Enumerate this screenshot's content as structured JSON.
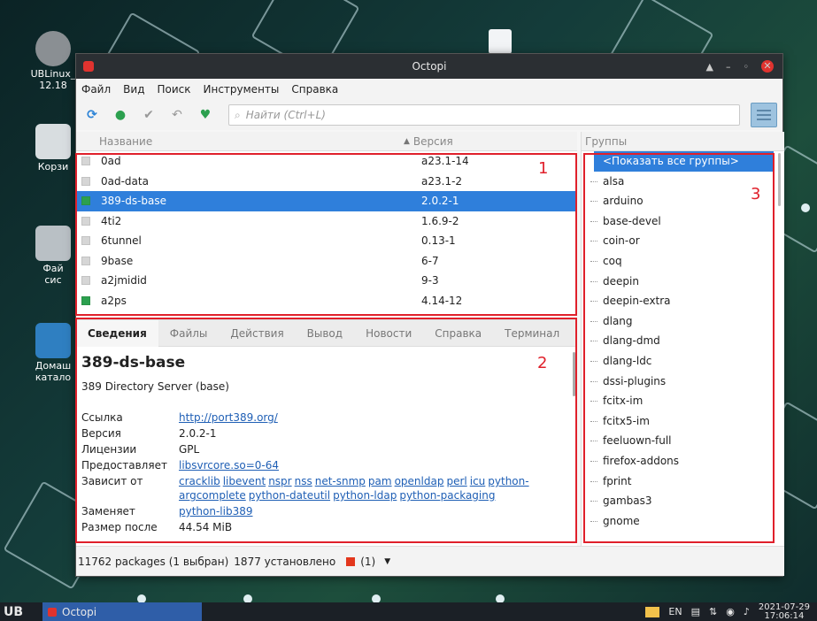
{
  "desktop": {
    "icons": [
      {
        "label": "UBLinux_\n12.18"
      },
      {
        "label": "Корзи"
      },
      {
        "label": "Фай\nсис"
      },
      {
        "label": "Домаш\nкатало"
      }
    ]
  },
  "window": {
    "title": "Octopi",
    "menu": [
      "Файл",
      "Вид",
      "Поиск",
      "Инструменты",
      "Справка"
    ],
    "search_placeholder": "Найти  (Ctrl+L)"
  },
  "package_list": {
    "header_name": "Название",
    "header_version": "Версия",
    "rows": [
      {
        "name": "0ad",
        "version": "a23.1-14",
        "installed": false,
        "selected": false
      },
      {
        "name": "0ad-data",
        "version": "a23.1-2",
        "installed": false,
        "selected": false
      },
      {
        "name": "389-ds-base",
        "version": "2.0.2-1",
        "installed": true,
        "selected": true
      },
      {
        "name": "4ti2",
        "version": "1.6.9-2",
        "installed": false,
        "selected": false
      },
      {
        "name": "6tunnel",
        "version": "0.13-1",
        "installed": false,
        "selected": false
      },
      {
        "name": "9base",
        "version": "6-7",
        "installed": false,
        "selected": false
      },
      {
        "name": "a2jmidid",
        "version": "9-3",
        "installed": false,
        "selected": false
      },
      {
        "name": "a2ps",
        "version": "4.14-12",
        "installed": true,
        "selected": false
      }
    ]
  },
  "groups": {
    "header": "Группы",
    "items": [
      "<Показать все группы>",
      "alsa",
      "arduino",
      "base-devel",
      "coin-or",
      "coq",
      "deepin",
      "deepin-extra",
      "dlang",
      "dlang-dmd",
      "dlang-ldc",
      "dssi-plugins",
      "fcitx-im",
      "fcitx5-im",
      "feeluown-full",
      "firefox-addons",
      "fprint",
      "gambas3",
      "gnome"
    ]
  },
  "details": {
    "tabs": [
      "Сведения",
      "Файлы",
      "Действия",
      "Вывод",
      "Новости",
      "Справка",
      "Терминал"
    ],
    "name": "389-ds-base",
    "description": "389 Directory Server (base)",
    "fields": {
      "link_label": "Ссылка",
      "link_value": "http://port389.org/",
      "version_label": "Версия",
      "version_value": "2.0.2-1",
      "license_label": "Лицензии",
      "license_value": "GPL",
      "provides_label": "Предоставляет",
      "provides_value": "libsvrcore.so=0-64",
      "depends_label": "Зависит от",
      "depends_line1": [
        "cracklib",
        "libevent",
        "nspr",
        "nss",
        "net-snmp",
        "pam",
        "openldap",
        "perl",
        "icu",
        "python-"
      ],
      "depends_line2": [
        "argcomplete",
        "python-dateutil",
        "python-ldap",
        "python-packaging"
      ],
      "replaces_label": "Заменяет",
      "replaces_value": "python-lib389",
      "size_label": "Размер после",
      "size_value": "44.54 MiB"
    }
  },
  "statusbar": {
    "packages": "11762 packages (1 выбран)",
    "installed": "1877 установлено",
    "count": "(1)"
  },
  "annotations": {
    "n1": "1",
    "n2": "2",
    "n3": "3"
  },
  "taskbar": {
    "logo": "UB",
    "task_label": "Octopi",
    "lang": "EN",
    "date": "2021-07-29",
    "time": "17:06:14"
  },
  "colors": {
    "selection": "#2f7fdb",
    "annotation": "#e0202b",
    "installed": "#2ca04f",
    "titlebar": "#2b2f33"
  }
}
